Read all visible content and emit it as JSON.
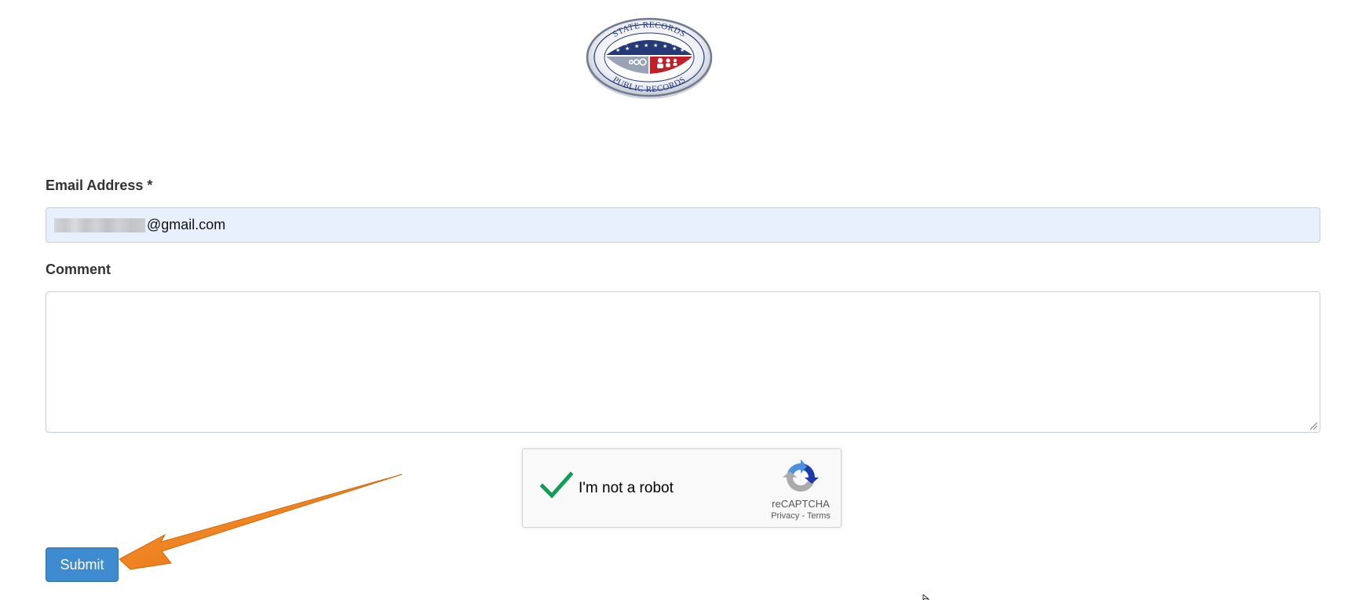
{
  "logo": {
    "top_text": "STATE RECORDS",
    "bottom_text": "PUBLIC RECORDS",
    "colors": {
      "navy": "#243a78",
      "red": "#c0202a",
      "silver": "#c7ccd6"
    }
  },
  "form": {
    "email_label": "Email Address *",
    "email_value_visible": "@gmail.com",
    "comment_label": "Comment",
    "comment_value": "",
    "submit_label": "Submit"
  },
  "captcha": {
    "label": "I'm not a robot",
    "brand": "reCAPTCHA",
    "privacy": "Privacy",
    "separator": " - ",
    "terms": "Terms",
    "checked": true
  },
  "annotation": {
    "arrow_color": "#f07d12",
    "points_to": "submit-button"
  },
  "colors": {
    "submit_bg": "#3f8bd0",
    "email_bg": "#e8f0fe",
    "check_green": "#0f9d58"
  }
}
